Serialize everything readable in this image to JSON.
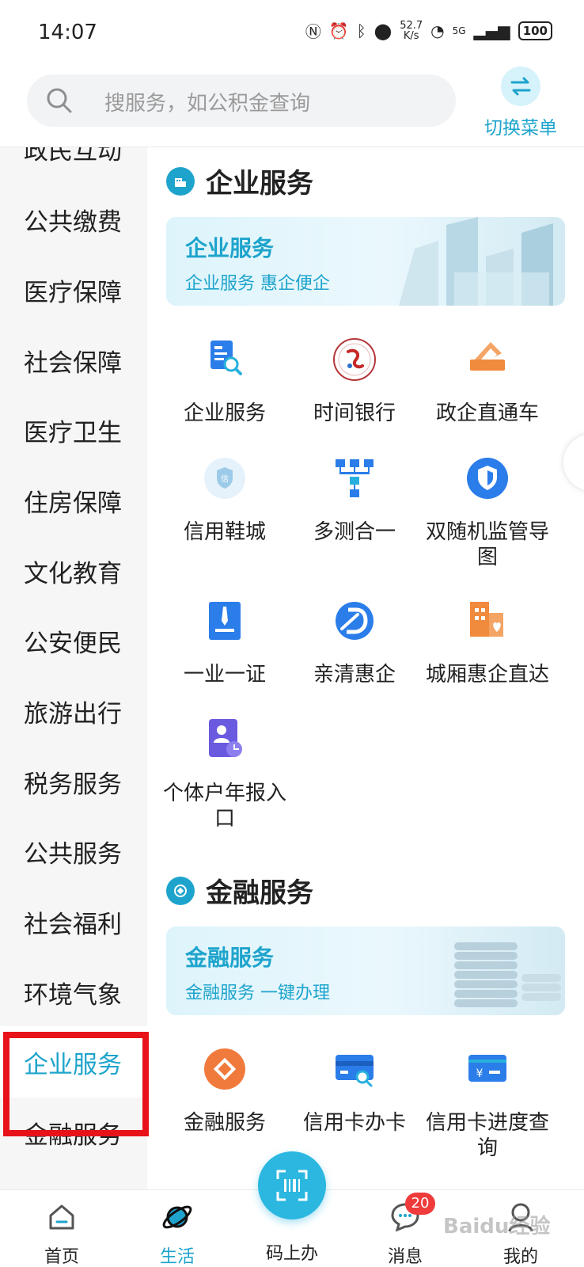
{
  "status_bar": {
    "time": "14:07",
    "net_speed": "52.7",
    "net_unit": "K/s",
    "network": "5G",
    "battery": "100"
  },
  "search": {
    "placeholder": "搜服务，如公积金查询"
  },
  "switch_menu": {
    "label": "切换菜单"
  },
  "nav": {
    "items": [
      "政民互动",
      "公共缴费",
      "医疗保障",
      "社会保障",
      "医疗卫生",
      "住房保障",
      "文化教育",
      "公安便民",
      "旅游出行",
      "税务服务",
      "公共服务",
      "社会福利",
      "环境气象",
      "企业服务",
      "金融服务"
    ],
    "active": "企业服务"
  },
  "sections": [
    {
      "title": "企业服务",
      "banner_title": "企业服务",
      "banner_subtitle": "企业服务 惠企便企",
      "items": [
        {
          "label": "企业服务",
          "icon": "document-search-icon"
        },
        {
          "label": "时间银行",
          "icon": "time-bank-logo-icon"
        },
        {
          "label": "政企直通车",
          "icon": "ticket-icon"
        },
        {
          "label": "信用鞋城",
          "icon": "credit-shield-icon"
        },
        {
          "label": "多测合一",
          "icon": "hierarchy-icon"
        },
        {
          "label": "双随机监管导图",
          "icon": "shield-icon"
        },
        {
          "label": "一业一证",
          "icon": "certificate-icon"
        },
        {
          "label": "亲清惠企",
          "icon": "d-logo-icon"
        },
        {
          "label": "城厢惠企直达",
          "icon": "building-heart-icon"
        },
        {
          "label": "个体户年报入口",
          "icon": "user-report-icon"
        }
      ]
    },
    {
      "title": "金融服务",
      "banner_title": "金融服务",
      "banner_subtitle": "金融服务 一键办理",
      "items": [
        {
          "label": "金融服务",
          "icon": "diamond-coin-icon"
        },
        {
          "label": "信用卡办卡",
          "icon": "credit-card-search-icon"
        },
        {
          "label": "信用卡进度查询",
          "icon": "yuan-card-icon"
        }
      ]
    }
  ],
  "tabbar": {
    "items": [
      {
        "label": "首页",
        "icon": "home-icon"
      },
      {
        "label": "生活",
        "icon": "planet-icon"
      },
      {
        "label": "码上办",
        "icon": "scan-code-icon"
      },
      {
        "label": "消息",
        "icon": "chat-icon"
      },
      {
        "label": "我的",
        "icon": "user-icon"
      }
    ],
    "active": "生活",
    "message_count": "20"
  },
  "watermark": "Baidu经验",
  "colors": {
    "accent": "#1ea4cc",
    "highlight": "#e8131a",
    "badge": "#ef3b3b"
  }
}
